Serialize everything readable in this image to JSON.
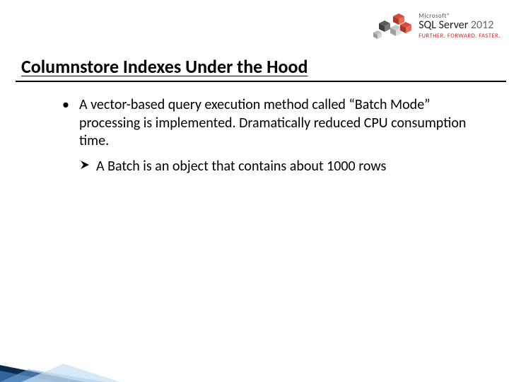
{
  "brand": {
    "vendor": "Microsoft®",
    "product": "SQL Server",
    "year": "2012",
    "tagline": "FURTHER. FORWARD. FASTER."
  },
  "title": "Columnstore Indexes Under the Hood",
  "bullets": {
    "b1": "A vector-based query execution method called “Batch Mode” processing is implemented. Dramatically reduced CPU consumption time.",
    "b2": "A Batch is an object that contains about 1000 rows"
  }
}
